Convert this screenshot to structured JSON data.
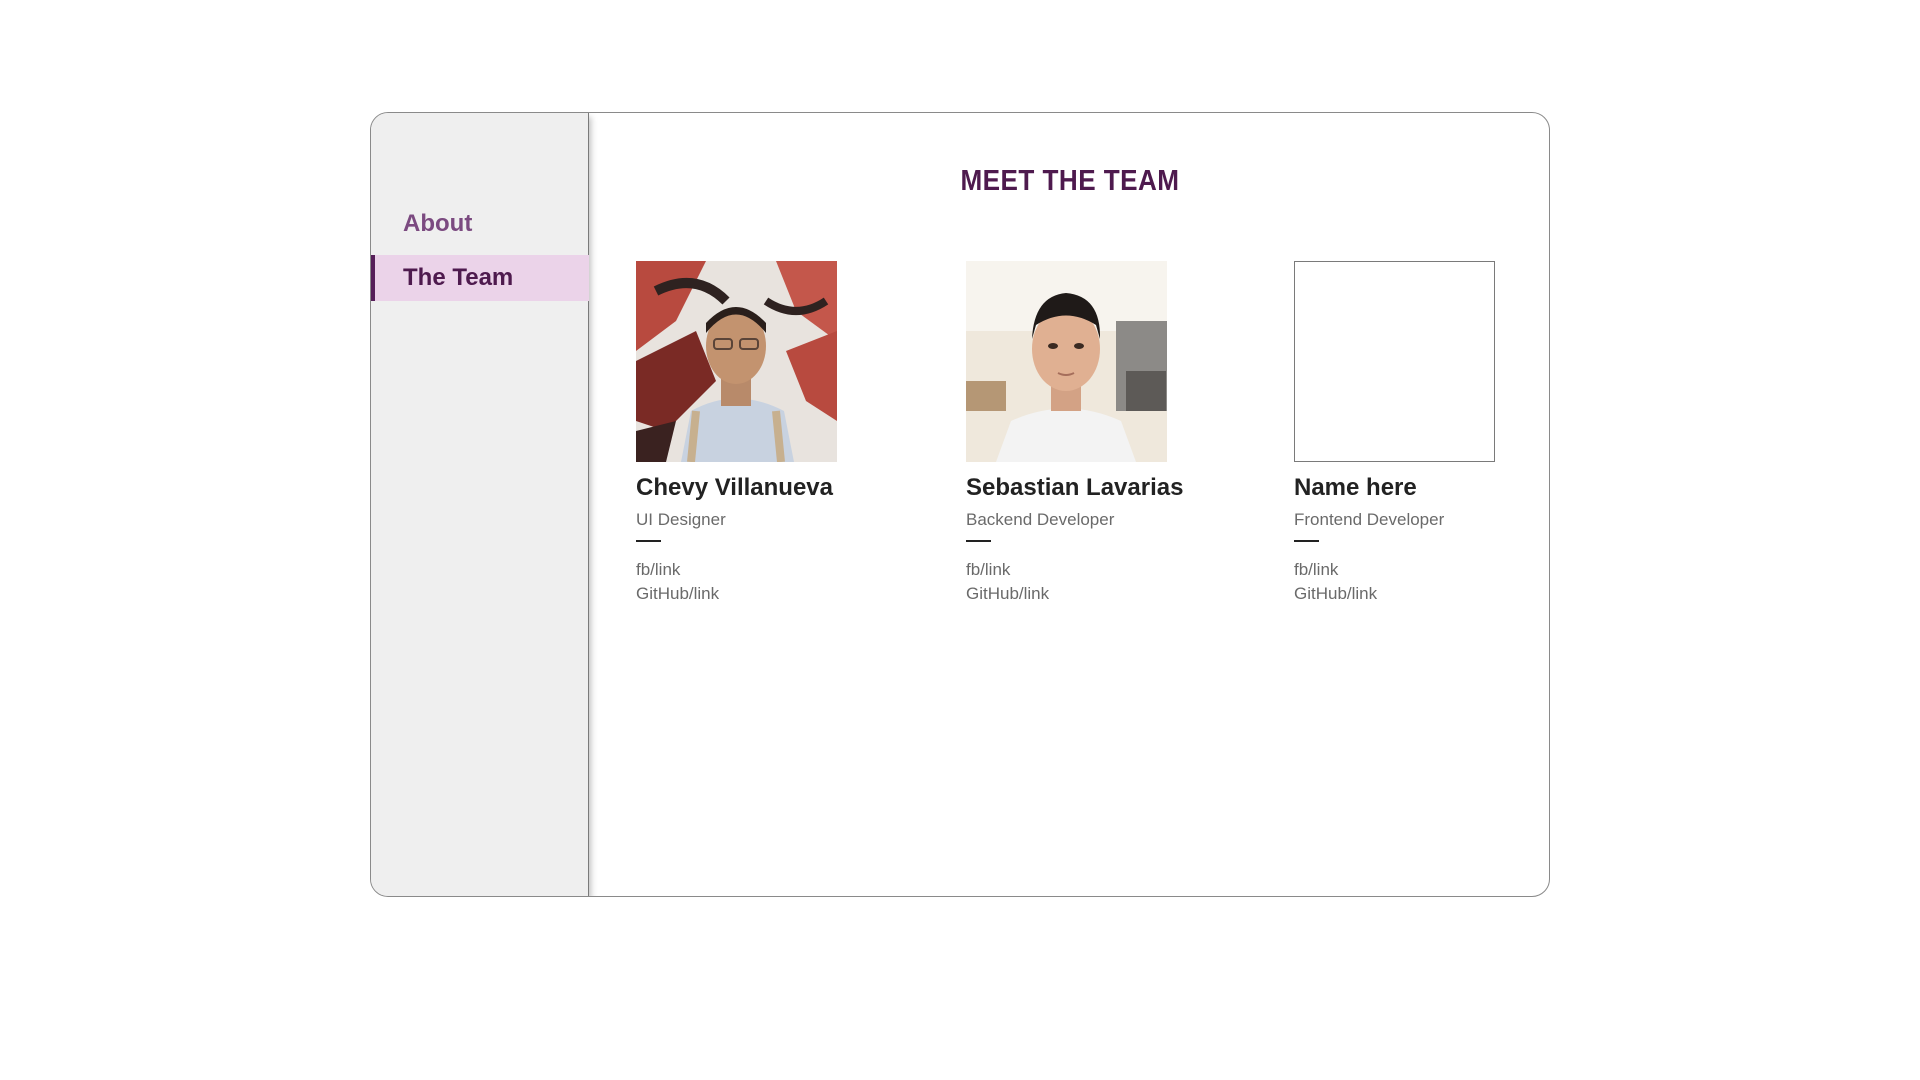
{
  "sidebar": {
    "items": [
      {
        "label": "About",
        "active": false
      },
      {
        "label": "The Team",
        "active": true
      }
    ]
  },
  "main": {
    "title": "MEET THE TEAM",
    "members": [
      {
        "name": "Chevy Villanueva",
        "role": "UI Designer",
        "links": [
          "fb/link",
          "GitHub/link"
        ],
        "photo": "portrait-photo"
      },
      {
        "name": "Sebastian Lavarias",
        "role": "Backend Developer",
        "links": [
          "fb/link",
          "GitHub/link"
        ],
        "photo": "portrait-photo"
      },
      {
        "name": "Name here",
        "role": "Frontend Developer",
        "links": [
          "fb/link",
          "GitHub/link"
        ],
        "photo": "empty-placeholder"
      }
    ]
  },
  "colors": {
    "accent": "#561f59",
    "active_bg": "#ebd3e9",
    "sidebar_bg": "#efefef",
    "inactive_nav": "#7b4a80"
  }
}
